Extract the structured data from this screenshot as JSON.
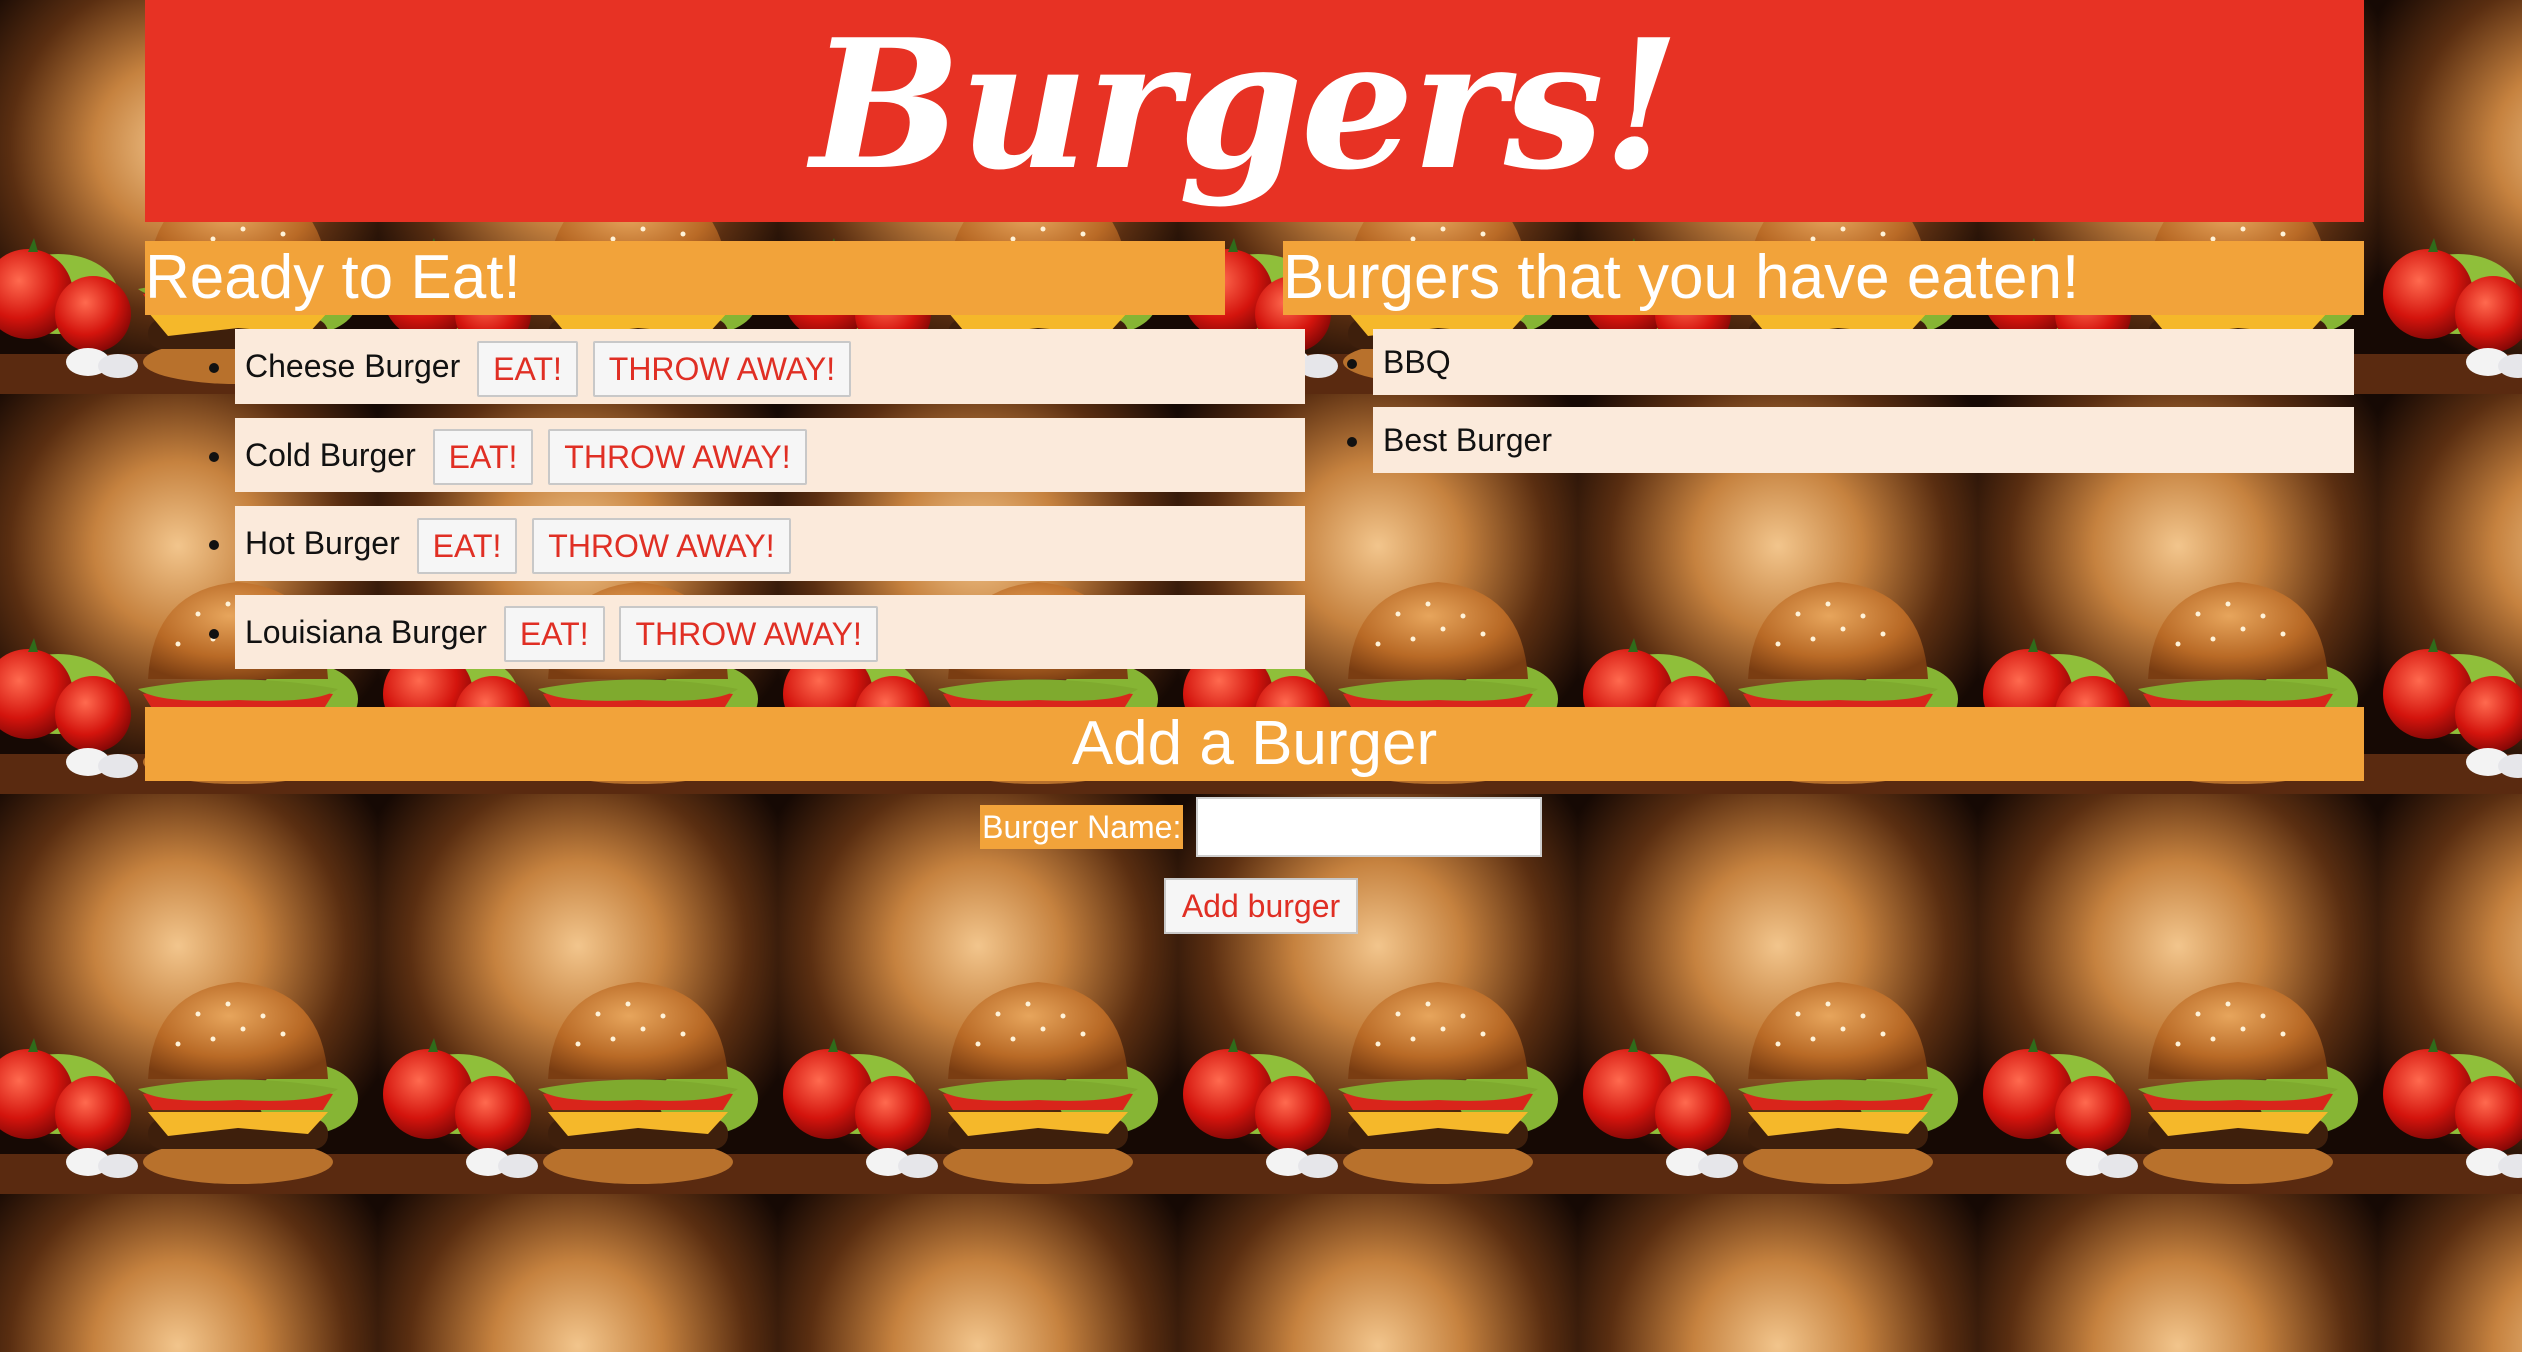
{
  "header": {
    "title": "Burgers!"
  },
  "ready_section": {
    "heading": "Ready to Eat!",
    "items": [
      {
        "name": "Cheese Burger",
        "eat_label": "EAT!",
        "throw_label": "THROW AWAY!"
      },
      {
        "name": "Cold Burger",
        "eat_label": "EAT!",
        "throw_label": "THROW AWAY!"
      },
      {
        "name": "Hot Burger",
        "eat_label": "EAT!",
        "throw_label": "THROW AWAY!"
      },
      {
        "name": "Louisiana Burger",
        "eat_label": "EAT!",
        "throw_label": "THROW AWAY!"
      }
    ]
  },
  "eaten_section": {
    "heading": "Burgers that you have eaten!",
    "items": [
      {
        "name": "BBQ"
      },
      {
        "name": "Best Burger"
      }
    ]
  },
  "add_section": {
    "heading": "Add a Burger",
    "label": "Burger Name:",
    "input_value": "",
    "submit_label": "Add burger"
  },
  "colors": {
    "header_red": "#e73224",
    "heading_orange": "#f2a33a",
    "item_bg": "#fbeadb",
    "button_text_red": "#e02f24"
  },
  "background": {
    "image_icon": "burger-tile-image"
  }
}
